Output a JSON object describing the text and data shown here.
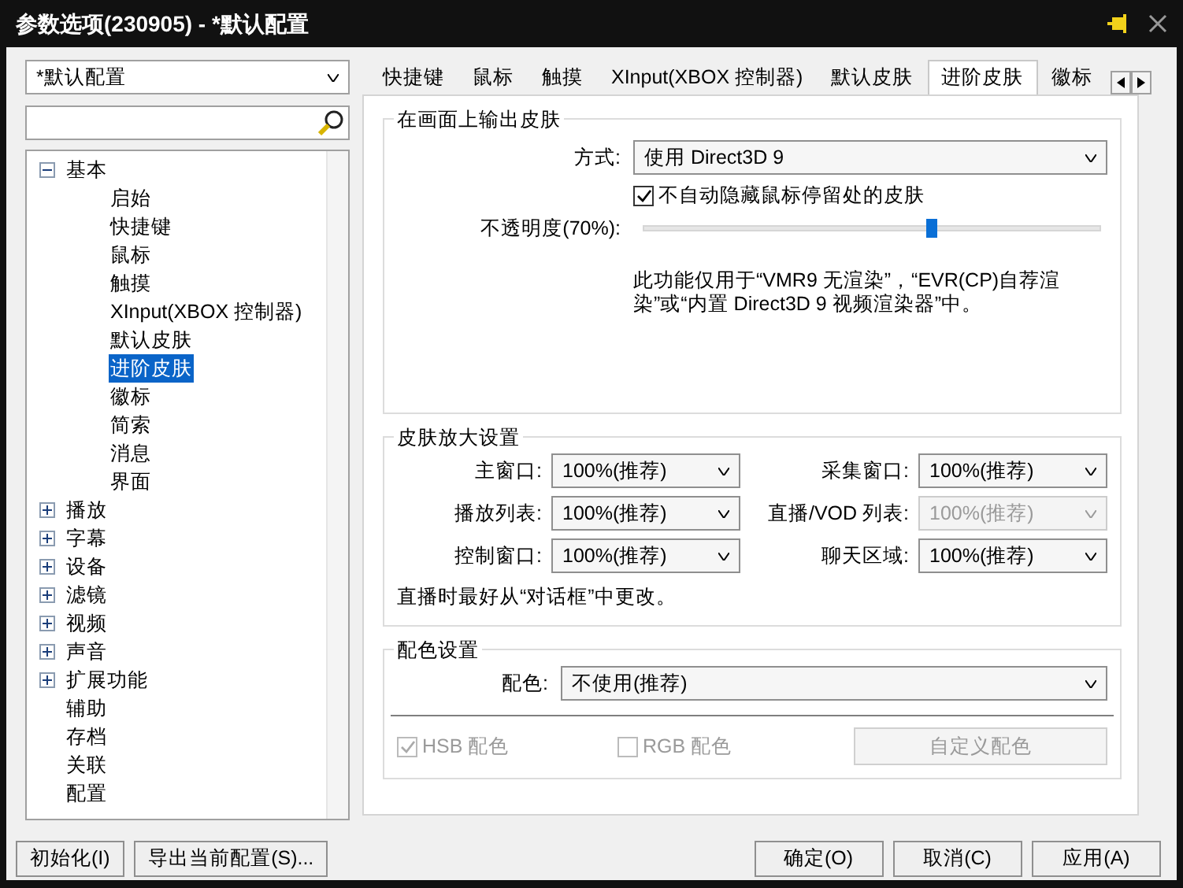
{
  "window": {
    "title": "参数选项(230905) - *默认配置"
  },
  "profile": {
    "value": "*默认配置"
  },
  "tree": [
    {
      "label": "基本",
      "kind": "group",
      "expanded": true,
      "selected": false,
      "children": [
        {
          "label": "启始",
          "kind": "leaf",
          "selected": false
        },
        {
          "label": "快捷键",
          "kind": "leaf",
          "selected": false
        },
        {
          "label": "鼠标",
          "kind": "leaf",
          "selected": false
        },
        {
          "label": "触摸",
          "kind": "leaf",
          "selected": false
        },
        {
          "label": "XInput(XBOX 控制器)",
          "kind": "leaf",
          "selected": false
        },
        {
          "label": "默认皮肤",
          "kind": "leaf",
          "selected": false
        },
        {
          "label": "进阶皮肤",
          "kind": "leaf",
          "selected": true
        },
        {
          "label": "徽标",
          "kind": "leaf",
          "selected": false
        },
        {
          "label": "简索",
          "kind": "leaf",
          "selected": false
        },
        {
          "label": "消息",
          "kind": "leaf",
          "selected": false
        },
        {
          "label": "界面",
          "kind": "leaf",
          "selected": false
        }
      ]
    },
    {
      "label": "播放",
      "kind": "group",
      "expanded": false,
      "selected": false
    },
    {
      "label": "字幕",
      "kind": "group",
      "expanded": false,
      "selected": false
    },
    {
      "label": "设备",
      "kind": "group",
      "expanded": false,
      "selected": false
    },
    {
      "label": "滤镜",
      "kind": "group",
      "expanded": false,
      "selected": false
    },
    {
      "label": "视频",
      "kind": "group",
      "expanded": false,
      "selected": false
    },
    {
      "label": "声音",
      "kind": "group",
      "expanded": false,
      "selected": false
    },
    {
      "label": "扩展功能",
      "kind": "group",
      "expanded": false,
      "selected": false
    },
    {
      "label": "辅助",
      "kind": "leaf",
      "selected": false
    },
    {
      "label": "存档",
      "kind": "leaf",
      "selected": false
    },
    {
      "label": "关联",
      "kind": "leaf",
      "selected": false
    },
    {
      "label": "配置",
      "kind": "leaf",
      "selected": false
    }
  ],
  "tabs": [
    {
      "label": "快捷键",
      "selected": false
    },
    {
      "label": "鼠标",
      "selected": false
    },
    {
      "label": "触摸",
      "selected": false
    },
    {
      "label": "XInput(XBOX 控制器)",
      "selected": false
    },
    {
      "label": "默认皮肤",
      "selected": false
    },
    {
      "label": "进阶皮肤",
      "selected": true
    },
    {
      "label": "徽标",
      "selected": false
    }
  ],
  "output_section": {
    "title": "在画面上输出皮肤",
    "mode_label": "方式:",
    "mode_value": "使用 Direct3D 9",
    "autohide": {
      "label": "不自动隐藏鼠标停留处的皮肤",
      "checked": true
    },
    "opacity": {
      "label": "不透明度(70%):",
      "level": 0.63
    },
    "note": "此功能仅用于“VMR9 无渲染”，“EVR(CP)自荐渲染”或“内置 Direct3D 9 视频渲染器”中。"
  },
  "zoom_section": {
    "title": "皮肤放大设置",
    "selects": [
      {
        "label": "主窗口:",
        "value": "100%(推荐)",
        "disabled": false
      },
      {
        "label": "采集窗口:",
        "value": "100%(推荐)",
        "disabled": false
      },
      {
        "label": "播放列表:",
        "value": "100%(推荐)",
        "disabled": false
      },
      {
        "label": "直播/VOD 列表:",
        "value": "100%(推荐)",
        "disabled": true
      },
      {
        "label": "控制窗口:",
        "value": "100%(推荐)",
        "disabled": false
      },
      {
        "label": "聊天区域:",
        "value": "100%(推荐)",
        "disabled": false
      }
    ],
    "note": "直播时最好从“对话框”中更改。"
  },
  "color_section": {
    "title": "配色设置",
    "label": "配色:",
    "value": "不使用(推荐)",
    "checkboxes": [
      {
        "label": "HSB 配色",
        "checked": true,
        "disabled": true
      },
      {
        "label": "RGB 配色",
        "checked": false,
        "disabled": true
      }
    ],
    "custom_button": {
      "label": "自定义配色",
      "disabled": true
    }
  },
  "footer_left": [
    {
      "label": "初始化(I)"
    },
    {
      "label": "导出当前配置(S)..."
    }
  ],
  "footer_right": [
    {
      "label": "确定(O)"
    },
    {
      "label": "取消(C)"
    },
    {
      "label": "应用(A)"
    }
  ]
}
